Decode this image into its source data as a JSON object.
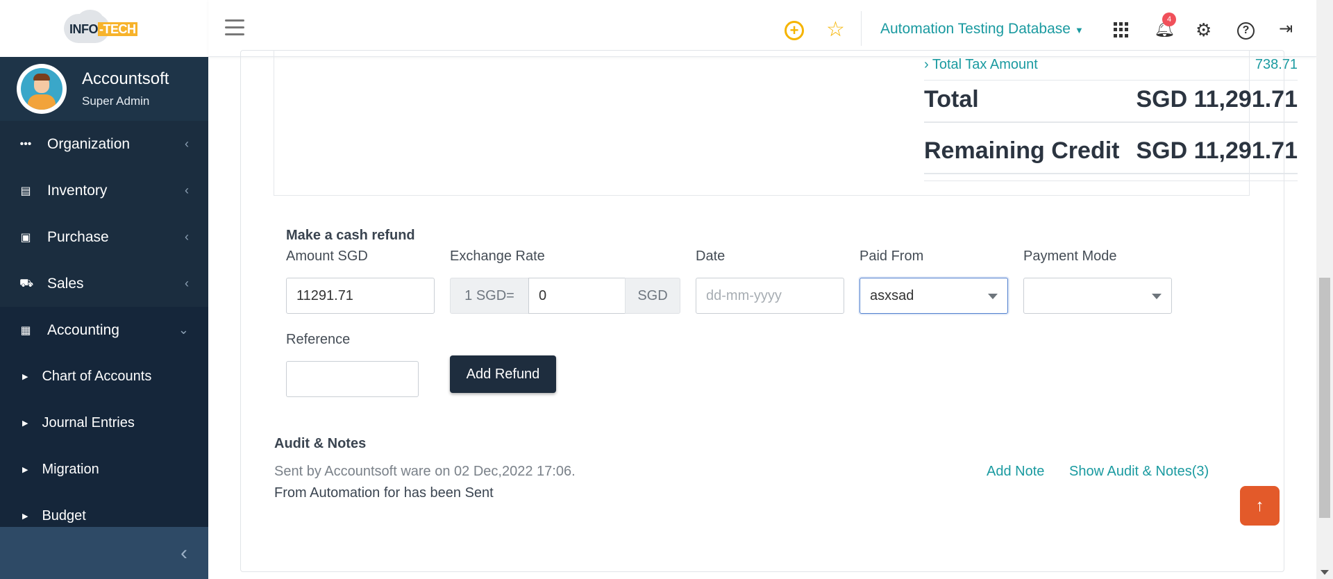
{
  "brand": {
    "logo_text_a": "INFO",
    "logo_text_b": "-TECH"
  },
  "profile": {
    "name": "Accountsoft",
    "role": "Super Admin"
  },
  "sidebar": {
    "items": [
      {
        "label": "Organization",
        "icon": "dots-icon"
      },
      {
        "label": "Inventory",
        "icon": "inventory-icon"
      },
      {
        "label": "Purchase",
        "icon": "bag-icon"
      },
      {
        "label": "Sales",
        "icon": "cart-icon"
      },
      {
        "label": "Accounting",
        "icon": "calculator-icon"
      }
    ],
    "sub_items": [
      {
        "label": "Chart of Accounts"
      },
      {
        "label": "Journal Entries"
      },
      {
        "label": "Migration"
      },
      {
        "label": "Budget"
      }
    ]
  },
  "topbar": {
    "database": "Automation Testing Database",
    "notification_count": "4"
  },
  "summary": {
    "tax_label": "Total Tax Amount",
    "tax_value": "738.71",
    "total_label": "Total",
    "total_value": "SGD 11,291.71",
    "remaining_label": "Remaining Credit",
    "remaining_value": "SGD 11,291.71"
  },
  "refund": {
    "title": "Make a cash refund",
    "amount_label": "Amount SGD",
    "amount_value": "11291.71",
    "exchange_label": "Exchange Rate",
    "exchange_prefix": "1 SGD=",
    "exchange_value": "0",
    "exchange_suffix": "SGD",
    "date_label": "Date",
    "date_placeholder": "dd-mm-yyyy",
    "paid_from_label": "Paid From",
    "paid_from_value": "asxsad",
    "payment_mode_label": "Payment Mode",
    "payment_mode_value": "",
    "reference_label": "Reference",
    "reference_value": "",
    "add_button": "Add Refund"
  },
  "audit": {
    "title": "Audit & Notes",
    "line1": "Sent by Accountsoft ware on 02 Dec,2022 17:06.",
    "line2": "From Automation for has been Sent",
    "add_note": "Add Note",
    "show_audit": "Show Audit & Notes(3)"
  },
  "colors": {
    "accent": "#1a9aa0",
    "sidebar": "#1b2d3f",
    "scroll_top": "#e35a2a",
    "star": "#f5b400"
  }
}
